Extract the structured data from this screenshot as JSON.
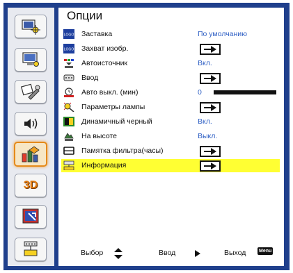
{
  "title": "Опции",
  "sidebar": {
    "items": [
      {
        "name": "image-settings-icon"
      },
      {
        "name": "display-settings-icon"
      },
      {
        "name": "setup-settings-icon"
      },
      {
        "name": "volume-icon"
      },
      {
        "name": "options-icon",
        "active": true
      },
      {
        "name": "3d-icon",
        "label": "3D"
      },
      {
        "name": "lan-icon"
      },
      {
        "name": "network-icon"
      }
    ]
  },
  "menu": {
    "rows": [
      {
        "label": "Заставка",
        "value": "По умолчанию",
        "icon": "logo-icon"
      },
      {
        "label": "Захват изобр.",
        "control": "enter",
        "icon": "logo-capture-icon"
      },
      {
        "label": "Автоисточник",
        "value": "Вкл.",
        "icon": "auto-source-icon"
      },
      {
        "label": "Ввод",
        "control": "enter",
        "icon": "input-icon"
      },
      {
        "label": "Авто выкл. (мин)",
        "value": "0",
        "control": "slider",
        "slider_value": 0,
        "icon": "timer-icon"
      },
      {
        "label": "Параметры лампы",
        "control": "enter",
        "icon": "lamp-icon"
      },
      {
        "label": "Динамичный черный",
        "value": "Вкл.",
        "icon": "dynamic-black-icon"
      },
      {
        "label": "На высоте",
        "value": "Выкл.",
        "icon": "altitude-icon"
      },
      {
        "label": "Памятка фильтра(часы)",
        "control": "enter",
        "icon": "filter-icon"
      },
      {
        "label": "Информация",
        "control": "enter",
        "icon": "info-icon",
        "selected": true
      }
    ]
  },
  "footer": {
    "select_label": "Выбор",
    "enter_label": "Ввод",
    "exit_label": "Выход",
    "menu_key": "Menu"
  },
  "colors": {
    "frame": "#1f3f8c",
    "sidebar": "#e8eaf0",
    "selection": "#ffff33",
    "value": "#2e5fc4",
    "active_accent": "#e58a1a"
  }
}
